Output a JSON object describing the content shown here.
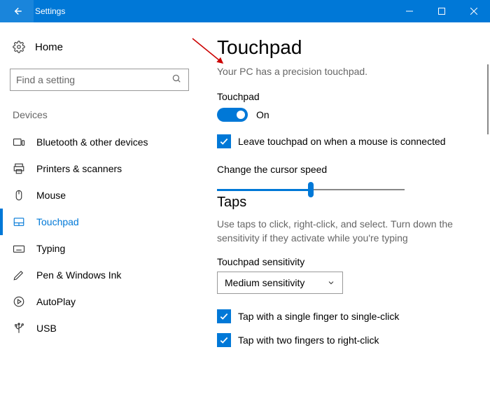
{
  "titlebar": {
    "title": "Settings"
  },
  "sidebar": {
    "home": "Home",
    "search_placeholder": "Find a setting",
    "group": "Devices",
    "items": [
      {
        "label": "Bluetooth & other devices"
      },
      {
        "label": "Printers & scanners"
      },
      {
        "label": "Mouse"
      },
      {
        "label": "Touchpad",
        "selected": true
      },
      {
        "label": "Typing"
      },
      {
        "label": "Pen & Windows Ink"
      },
      {
        "label": "AutoPlay"
      },
      {
        "label": "USB"
      }
    ]
  },
  "main": {
    "heading": "Touchpad",
    "subtext": "Your PC has a precision touchpad.",
    "touchpad_label": "Touchpad",
    "toggle_state": "On",
    "cb_leave_on": "Leave touchpad on when a mouse is connected",
    "cursor_speed_label": "Change the cursor speed",
    "taps_heading": "Taps",
    "taps_desc": "Use taps to click, right-click, and select. Turn down the sensitivity if they activate while you're typing",
    "sensitivity_label": "Touchpad sensitivity",
    "sensitivity_value": "Medium sensitivity",
    "cb_single_tap": "Tap with a single finger to single-click",
    "cb_two_tap": "Tap with two fingers to right-click"
  }
}
